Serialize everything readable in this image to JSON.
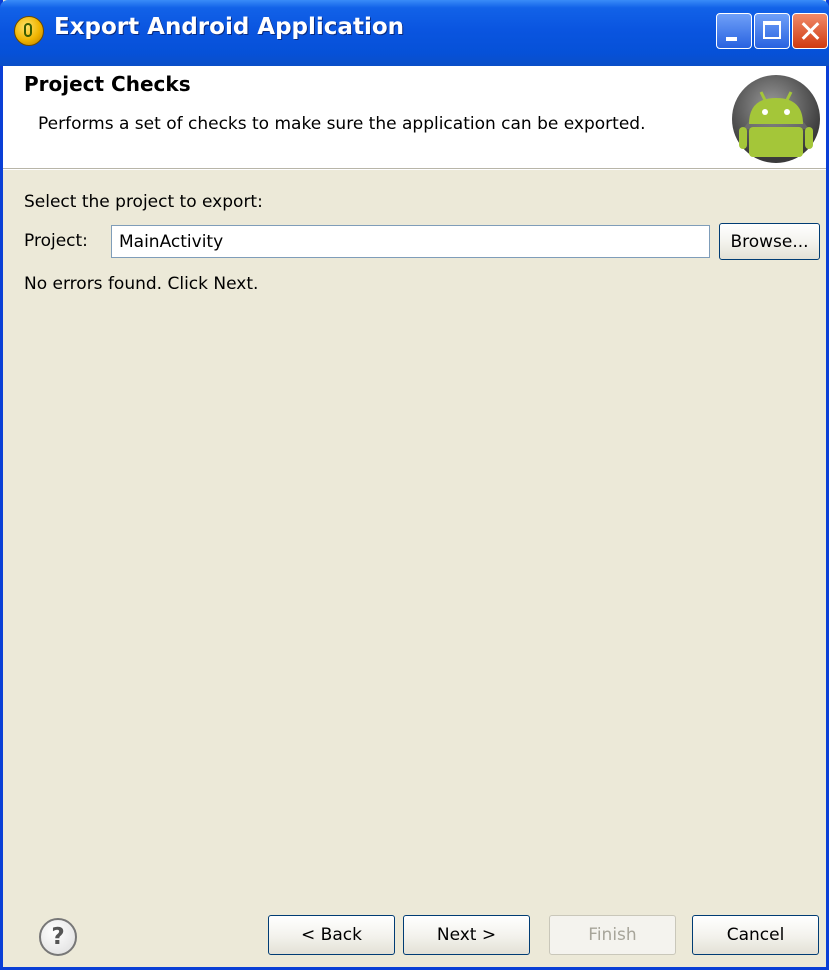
{
  "window": {
    "title": "Export Android Application"
  },
  "header": {
    "title": "Project Checks",
    "description": "Performs a set of checks to make sure the application can be exported."
  },
  "form": {
    "select_label": "Select the project to export:",
    "project_label": "Project:",
    "project_value": "MainActivity",
    "browse_label": "Browse...",
    "status_text": "No errors found. Click Next."
  },
  "footer": {
    "help_glyph": "?",
    "back_label": "< Back",
    "next_label": "Next >",
    "finish_label": "Finish",
    "cancel_label": "Cancel"
  },
  "colors": {
    "titlebar": "#0a55e0",
    "dialog_bg": "#ece9d8",
    "android_green": "#a4c639"
  }
}
